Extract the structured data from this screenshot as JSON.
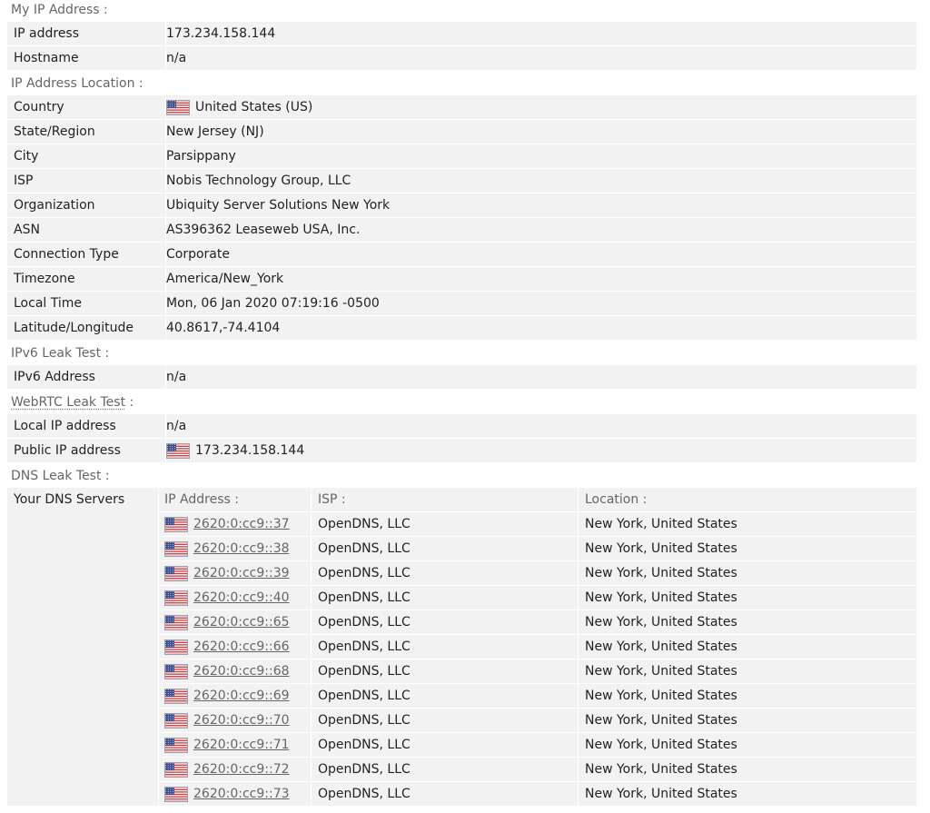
{
  "sections": {
    "my_ip": "My IP Address",
    "location": "IP Address Location",
    "ipv6": "IPv6 Leak Test",
    "webrtc": "WebRTC Leak Test",
    "dns": "DNS Leak Test",
    "colon": " :"
  },
  "my_ip": {
    "ip_label": "IP address",
    "ip_value": "173.234.158.144",
    "host_label": "Hostname",
    "host_value": "n/a"
  },
  "location": {
    "country_label": "Country",
    "country_value": "United States (US)",
    "state_label": "State/Region",
    "state_value": "New Jersey (NJ)",
    "city_label": "City",
    "city_value": "Parsippany",
    "isp_label": "ISP",
    "isp_value": "Nobis Technology Group, LLC",
    "org_label": "Organization",
    "org_value": "Ubiquity Server Solutions New York",
    "asn_label": "ASN",
    "asn_value": "AS396362 Leaseweb USA, Inc.",
    "conn_label": "Connection Type",
    "conn_value": "Corporate",
    "tz_label": "Timezone",
    "tz_value": "America/New_York",
    "time_label": "Local Time",
    "time_value": "Mon, 06 Jan 2020 07:19:16 -0500",
    "latlng_label": "Latitude/Longitude",
    "latlng_value": "40.8617,-74.4104"
  },
  "ipv6": {
    "addr_label": "IPv6 Address",
    "addr_value": "n/a"
  },
  "webrtc": {
    "local_label": "Local IP address",
    "local_value": "n/a",
    "public_label": "Public IP address",
    "public_value": "173.234.158.144"
  },
  "dns": {
    "servers_label": "Your DNS Servers",
    "headers": {
      "ip": "IP Address :",
      "isp": "ISP :",
      "location": "Location :"
    },
    "rows": [
      {
        "ip": "2620:0:cc9::37",
        "isp": "OpenDNS, LLC",
        "location": "New York, United States"
      },
      {
        "ip": "2620:0:cc9::38",
        "isp": "OpenDNS, LLC",
        "location": "New York, United States"
      },
      {
        "ip": "2620:0:cc9::39",
        "isp": "OpenDNS, LLC",
        "location": "New York, United States"
      },
      {
        "ip": "2620:0:cc9::40",
        "isp": "OpenDNS, LLC",
        "location": "New York, United States"
      },
      {
        "ip": "2620:0:cc9::65",
        "isp": "OpenDNS, LLC",
        "location": "New York, United States"
      },
      {
        "ip": "2620:0:cc9::66",
        "isp": "OpenDNS, LLC",
        "location": "New York, United States"
      },
      {
        "ip": "2620:0:cc9::68",
        "isp": "OpenDNS, LLC",
        "location": "New York, United States"
      },
      {
        "ip": "2620:0:cc9::69",
        "isp": "OpenDNS, LLC",
        "location": "New York, United States"
      },
      {
        "ip": "2620:0:cc9::70",
        "isp": "OpenDNS, LLC",
        "location": "New York, United States"
      },
      {
        "ip": "2620:0:cc9::71",
        "isp": "OpenDNS, LLC",
        "location": "New York, United States"
      },
      {
        "ip": "2620:0:cc9::72",
        "isp": "OpenDNS, LLC",
        "location": "New York, United States"
      },
      {
        "ip": "2620:0:cc9::73",
        "isp": "OpenDNS, LLC",
        "location": "New York, United States"
      }
    ]
  },
  "colors": {
    "row_bg": "#f2f2f2",
    "section_text": "#666666",
    "link": "#666666"
  },
  "icons": {
    "flag": "us-flag-icon"
  }
}
